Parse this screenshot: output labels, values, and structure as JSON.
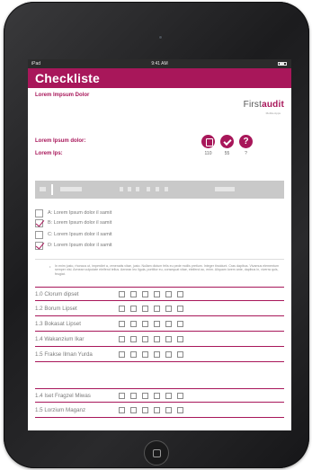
{
  "status_bar": {
    "carrier": "iPad",
    "time": "9:41 AM"
  },
  "app": {
    "title": "Checkliste",
    "subtitle": "Lorem Impsum Dolor"
  },
  "logo": {
    "first": "First",
    "second": "audit",
    "tagline": "Mobile Apps"
  },
  "fields": [
    {
      "label": "Lorem Ipsum dolor:"
    },
    {
      "label": "Lorem Ips:"
    }
  ],
  "stats": [
    {
      "icon": "document-icon",
      "value": "110"
    },
    {
      "icon": "check-icon",
      "value": "55"
    },
    {
      "icon": "question-icon",
      "value": "?"
    }
  ],
  "options": [
    {
      "label": "A: Lorem Ipsum dolor il samit",
      "checked": false
    },
    {
      "label": "B: Lorem Ipsum dolor il samit",
      "checked": true
    },
    {
      "label": "C: Lorem Ipsum dolor il samit",
      "checked": false
    },
    {
      "label": "D: Lorem Ipsum dolor il samit",
      "checked": true
    }
  ],
  "note": "In enim justo, rhoncus ut, imperdiet a, venenatis vitae, justo. Nullam dictum felis eu pede mollis pretium. Integer tincidunt. Cras dapibus. Vivamus elementum semper nisi. Aenean vulputate eleifend tellus. Aenean leo ligula, porttitor eu, consequat vitae, eleifend ac, enim. Aliquam lorem ante, dapibus in, viverra quis, feugiat.",
  "rows_top": [
    {
      "label": "1.0 Clorum dipset"
    },
    {
      "label": "1.2 Borum Lipset"
    },
    {
      "label": "1.3 Bokasat Lipset"
    },
    {
      "label": "1.4 Wakanzium Ikar"
    },
    {
      "label": "1.5 Frakse Ilman Yurda"
    }
  ],
  "rows_bottom": [
    {
      "label": "1.4 Iset Fragzel Miwas"
    },
    {
      "label": "1.5 Lorzium Maganz"
    }
  ],
  "cells_per_row": 6,
  "colors": {
    "accent": "#a8175a",
    "toolbar": "#c9c9c9"
  }
}
